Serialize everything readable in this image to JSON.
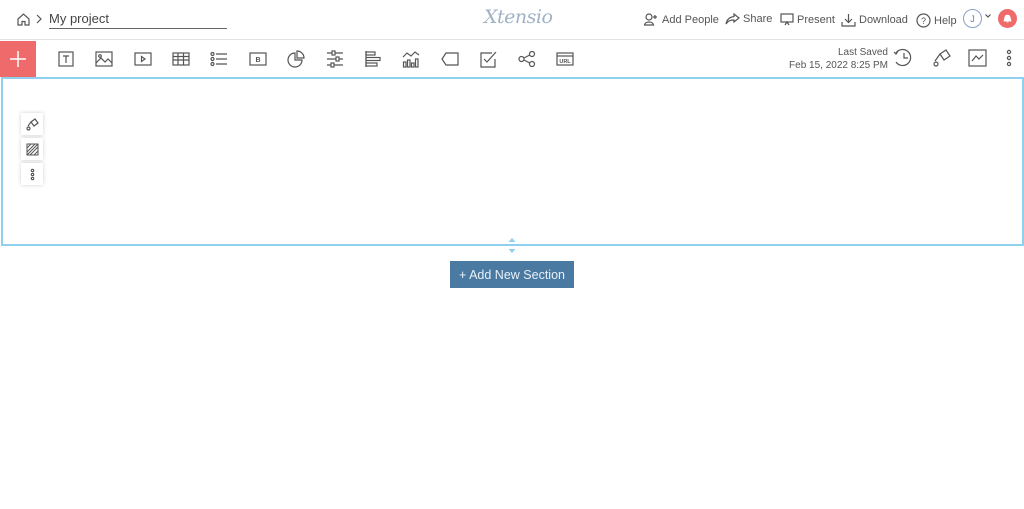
{
  "header": {
    "project_title": "My project",
    "logo": "Xtensio",
    "actions": [
      {
        "label": "Add People",
        "icon": "add-person-icon"
      },
      {
        "label": "Share",
        "icon": "share-icon"
      },
      {
        "label": "Present",
        "icon": "present-icon"
      },
      {
        "label": "Download",
        "icon": "download-icon"
      },
      {
        "label": "Help",
        "icon": "help-icon"
      }
    ],
    "avatar_initial": "J",
    "notification_color": "#ef6b6b"
  },
  "toolbar": {
    "add_color": "#ef6b6b",
    "tools": [
      "text-icon",
      "image-icon",
      "video-icon",
      "table-icon",
      "list-icon",
      "button-icon",
      "pie-chart-icon",
      "sliders-icon",
      "bar-chart-icon",
      "line-chart-icon",
      "tag-icon",
      "checkbox-icon",
      "share-nodes-icon",
      "url-icon"
    ],
    "last_saved_label": "Last Saved",
    "last_saved_time": "Feb 15, 2022 8:25 PM"
  },
  "canvas": {
    "section_border_color": "#8fd0ef",
    "add_section_label": "+ Add New Section",
    "add_section_color": "#4a7aa2"
  }
}
